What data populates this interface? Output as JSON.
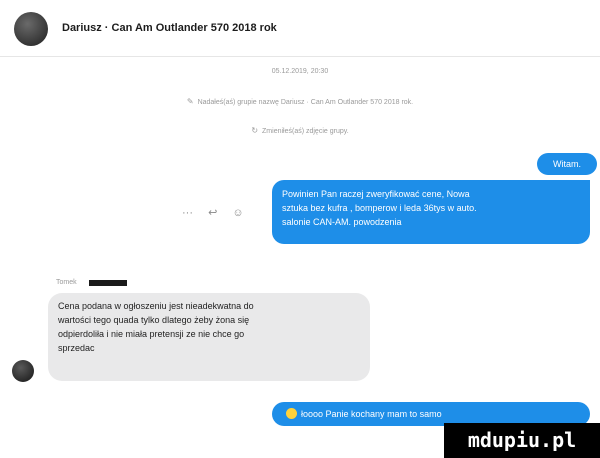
{
  "header": {
    "title": "Dariusz · Can Am Outlander 570 2018 rok"
  },
  "system_messages": {
    "timestamp": "05.12.2019, 20:30",
    "renamed": "Nadałeś(aś) grupie nazwę Dariusz · Can Am Outlander 570 2018 rok.",
    "photo_changed": "Zmieniłeś(aś) zdjęcie grupy."
  },
  "messages": {
    "witam": "Witam.",
    "offer_lines": [
      "Powinien Pan raczej zweryfikować cene, Nowa",
      "sztuka bez kufra , bomperow i leda 36tys w auto.",
      "salonie CAN-AM. powodzenia"
    ],
    "sender_name": "Tomek",
    "reply_lines": [
      "Cena podana w ogłoszeniu jest nieadekwatna do",
      "wartości tego quada tylko dlatego żeby żona się",
      "odpierdoliła i nie miała pretensji ze nie chce go",
      "sprzedac"
    ],
    "last": "łoooo Panie kochany mam to samo"
  },
  "icons": {
    "pencil": "✎",
    "refresh": "↻",
    "more": "···",
    "reply": "↩",
    "emoji": "☺"
  },
  "watermark": "mdupiu.pl",
  "colors": {
    "sent_bubble": "#1e8ee8",
    "received_bubble": "#e9e9ea"
  }
}
